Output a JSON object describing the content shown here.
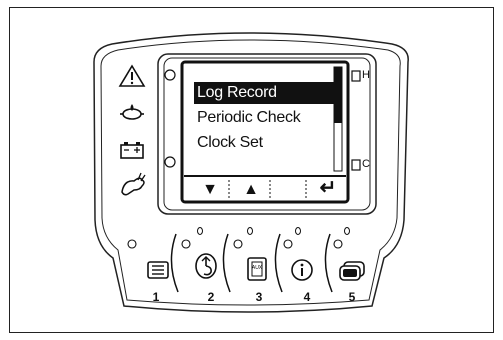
{
  "display": {
    "menu": [
      {
        "label": "Log Record",
        "selected": true
      },
      {
        "label": "Periodic Check",
        "selected": false
      },
      {
        "label": "Clock Set",
        "selected": false
      }
    ],
    "softkeys": [
      {
        "icon": "triangle-down-icon",
        "glyph": "▼"
      },
      {
        "icon": "triangle-up-icon",
        "glyph": "▲"
      },
      {
        "icon": "blank",
        "glyph": ""
      },
      {
        "icon": "enter-icon",
        "glyph": "↵"
      }
    ]
  },
  "gauge_labels": {
    "high": "H",
    "cold": "C"
  },
  "warning_icons": [
    "warning-triangle-icon",
    "engine-oil-pressure-icon",
    "battery-charge-icon",
    "rabbit-speed-icon"
  ],
  "buttons": [
    {
      "number": "1",
      "icon": "menu-list-icon"
    },
    {
      "number": "2",
      "icon": "crane-hook-icon"
    },
    {
      "number": "3",
      "icon": "aux-icon",
      "icon_text": "AUX"
    },
    {
      "number": "4",
      "icon": "info-icon"
    },
    {
      "number": "5",
      "icon": "screen-switch-icon"
    }
  ]
}
